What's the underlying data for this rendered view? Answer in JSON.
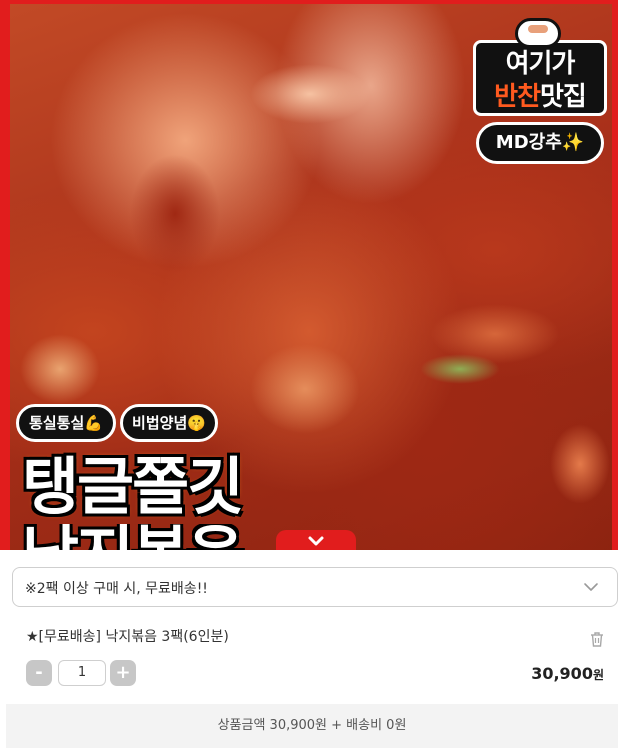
{
  "hero": {
    "sticker_top_line1": "여기가",
    "sticker_top_line2_highlight": "반찬",
    "sticker_top_line2_rest": "맛집",
    "sticker_md": "MD강추✨",
    "badge_1": "통실통실💪",
    "badge_2": "비법양념🤫",
    "headline": "탱글쫄깃",
    "headline_2": "낙지볶음",
    "icons": [
      "bowl-icon",
      "chevron-down-icon"
    ],
    "accent_color": "#e11d1d"
  },
  "order": {
    "option_text": "※2팩 이상 구매 시, 무료배송!!",
    "item_name": "★[무료배송] 낙지볶음 3팩(6인분)",
    "minus_label": "-",
    "plus_label": "+",
    "quantity": "1",
    "price": "30,900",
    "price_unit": "원",
    "summary": "상품금액 30,900원 + 배송비 0원"
  }
}
